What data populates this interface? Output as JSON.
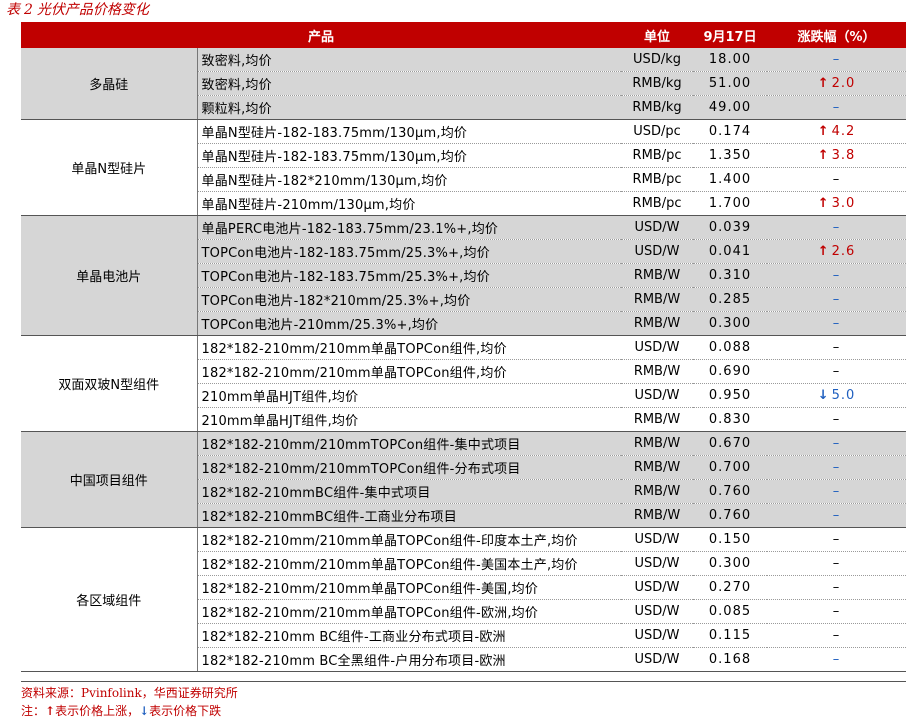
{
  "title": {
    "prefix": "表",
    "number": "2",
    "text": "光伏产品价格变化"
  },
  "header": {
    "product": "产品",
    "unit": "单位",
    "date": "9月17日",
    "change": "涨跌幅（%）"
  },
  "groups": [
    {
      "category": "多晶硅",
      "shade": true,
      "rows": [
        {
          "product": "致密料,均价",
          "unit": "USD/kg",
          "price": "18.00",
          "dir": "none",
          "change": "–",
          "dash_color": "blue"
        },
        {
          "product": "致密料,均价",
          "unit": "RMB/kg",
          "price": "51.00",
          "dir": "up",
          "change": "2.0"
        },
        {
          "product": "颗粒料,均价",
          "unit": "RMB/kg",
          "price": "49.00",
          "dir": "none",
          "change": "–",
          "dash_color": "blue"
        }
      ]
    },
    {
      "category": "单晶N型硅片",
      "shade": false,
      "rows": [
        {
          "product": "单晶N型硅片-182-183.75mm/130μm,均价",
          "unit": "USD/pc",
          "price": "0.174",
          "dir": "up",
          "change": "4.2"
        },
        {
          "product": "单晶N型硅片-182-183.75mm/130μm,均价",
          "unit": "RMB/pc",
          "price": "1.350",
          "dir": "up",
          "change": "3.8"
        },
        {
          "product": "单晶N型硅片-182*210mm/130μm,均价",
          "unit": "RMB/pc",
          "price": "1.400",
          "dir": "none",
          "change": "–",
          "dash_color": "black"
        },
        {
          "product": "单晶N型硅片-210mm/130μm,均价",
          "unit": "RMB/pc",
          "price": "1.700",
          "dir": "up",
          "change": "3.0"
        }
      ]
    },
    {
      "category": "单晶电池片",
      "shade": true,
      "rows": [
        {
          "product": "单晶PERC电池片-182-183.75mm/23.1%+,均价",
          "unit": "USD/W",
          "price": "0.039",
          "dir": "none",
          "change": "–",
          "dash_color": "blue"
        },
        {
          "product": "TOPCon电池片-182-183.75mm/25.3%+,均价",
          "unit": "USD/W",
          "price": "0.041",
          "dir": "up",
          "change": "2.6"
        },
        {
          "product": "TOPCon电池片-182-183.75mm/25.3%+,均价",
          "unit": "RMB/W",
          "price": "0.310",
          "dir": "none",
          "change": "–",
          "dash_color": "blue"
        },
        {
          "product": "TOPCon电池片-182*210mm/25.3%+,均价",
          "unit": "RMB/W",
          "price": "0.285",
          "dir": "none",
          "change": "–",
          "dash_color": "blue"
        },
        {
          "product": "TOPCon电池片-210mm/25.3%+,均价",
          "unit": "RMB/W",
          "price": "0.300",
          "dir": "none",
          "change": "–",
          "dash_color": "blue"
        }
      ]
    },
    {
      "category": "双面双玻N型组件",
      "shade": false,
      "rows": [
        {
          "product": "182*182-210mm/210mm单晶TOPCon组件,均价",
          "unit": "USD/W",
          "price": "0.088",
          "dir": "none",
          "change": "–",
          "dash_color": "black"
        },
        {
          "product": "182*182-210mm/210mm单晶TOPCon组件,均价",
          "unit": "RMB/W",
          "price": "0.690",
          "dir": "none",
          "change": "–",
          "dash_color": "black"
        },
        {
          "product": "210mm单晶HJT组件,均价",
          "unit": "USD/W",
          "price": "0.950",
          "dir": "down",
          "change": "5.0"
        },
        {
          "product": "210mm单晶HJT组件,均价",
          "unit": "RMB/W",
          "price": "0.830",
          "dir": "none",
          "change": "–",
          "dash_color": "black"
        }
      ]
    },
    {
      "category": "中国项目组件",
      "shade": true,
      "rows": [
        {
          "product": "182*182-210mm/210mmTOPCon组件-集中式项目",
          "unit": "RMB/W",
          "price": "0.670",
          "dir": "none",
          "change": "–",
          "dash_color": "blue"
        },
        {
          "product": "182*182-210mm/210mmTOPCon组件-分布式项目",
          "unit": "RMB/W",
          "price": "0.700",
          "dir": "none",
          "change": "–",
          "dash_color": "blue"
        },
        {
          "product": "182*182-210mmBC组件-集中式项目",
          "unit": "RMB/W",
          "price": "0.760",
          "dir": "none",
          "change": "–",
          "dash_color": "blue"
        },
        {
          "product": "182*182-210mmBC组件-工商业分布项目",
          "unit": "RMB/W",
          "price": "0.760",
          "dir": "none",
          "change": "–",
          "dash_color": "blue"
        }
      ]
    },
    {
      "category": "各区域组件",
      "shade": false,
      "rows": [
        {
          "product": "182*182-210mm/210mm单晶TOPCon组件-印度本土产,均价",
          "unit": "USD/W",
          "price": "0.150",
          "dir": "none",
          "change": "–",
          "dash_color": "black"
        },
        {
          "product": "182*182-210mm/210mm单晶TOPCon组件-美国本土产,均价",
          "unit": "USD/W",
          "price": "0.300",
          "dir": "none",
          "change": "–",
          "dash_color": "black"
        },
        {
          "product": "182*182-210mm/210mm单晶TOPCon组件-美国,均价",
          "unit": "USD/W",
          "price": "0.270",
          "dir": "none",
          "change": "–",
          "dash_color": "black"
        },
        {
          "product": "182*182-210mm/210mm单晶TOPCon组件-欧洲,均价",
          "unit": "USD/W",
          "price": "0.085",
          "dir": "none",
          "change": "–",
          "dash_color": "black"
        },
        {
          "product": "182*182-210mm BC组件-工商业分布式项目-欧洲",
          "unit": "USD/W",
          "price": "0.115",
          "dir": "none",
          "change": "–",
          "dash_color": "black"
        },
        {
          "product": "182*182-210mm BC全黑组件-户用分布项目-欧洲",
          "unit": "USD/W",
          "price": "0.168",
          "dir": "none",
          "change": "–",
          "dash_color": "blue"
        }
      ]
    }
  ],
  "footer": {
    "source": "资料来源：Pvinfolink，华西证券研究所",
    "note_prefix": "注：",
    "up_arrow": "↑",
    "up_text": "表示价格上涨，",
    "down_arrow": "↓",
    "down_text": "表示价格下跌"
  },
  "colors": {
    "header_bg": "#c00000",
    "shade": "#d6d6d6",
    "up": "#c00000",
    "down": "#1f5fbf"
  }
}
